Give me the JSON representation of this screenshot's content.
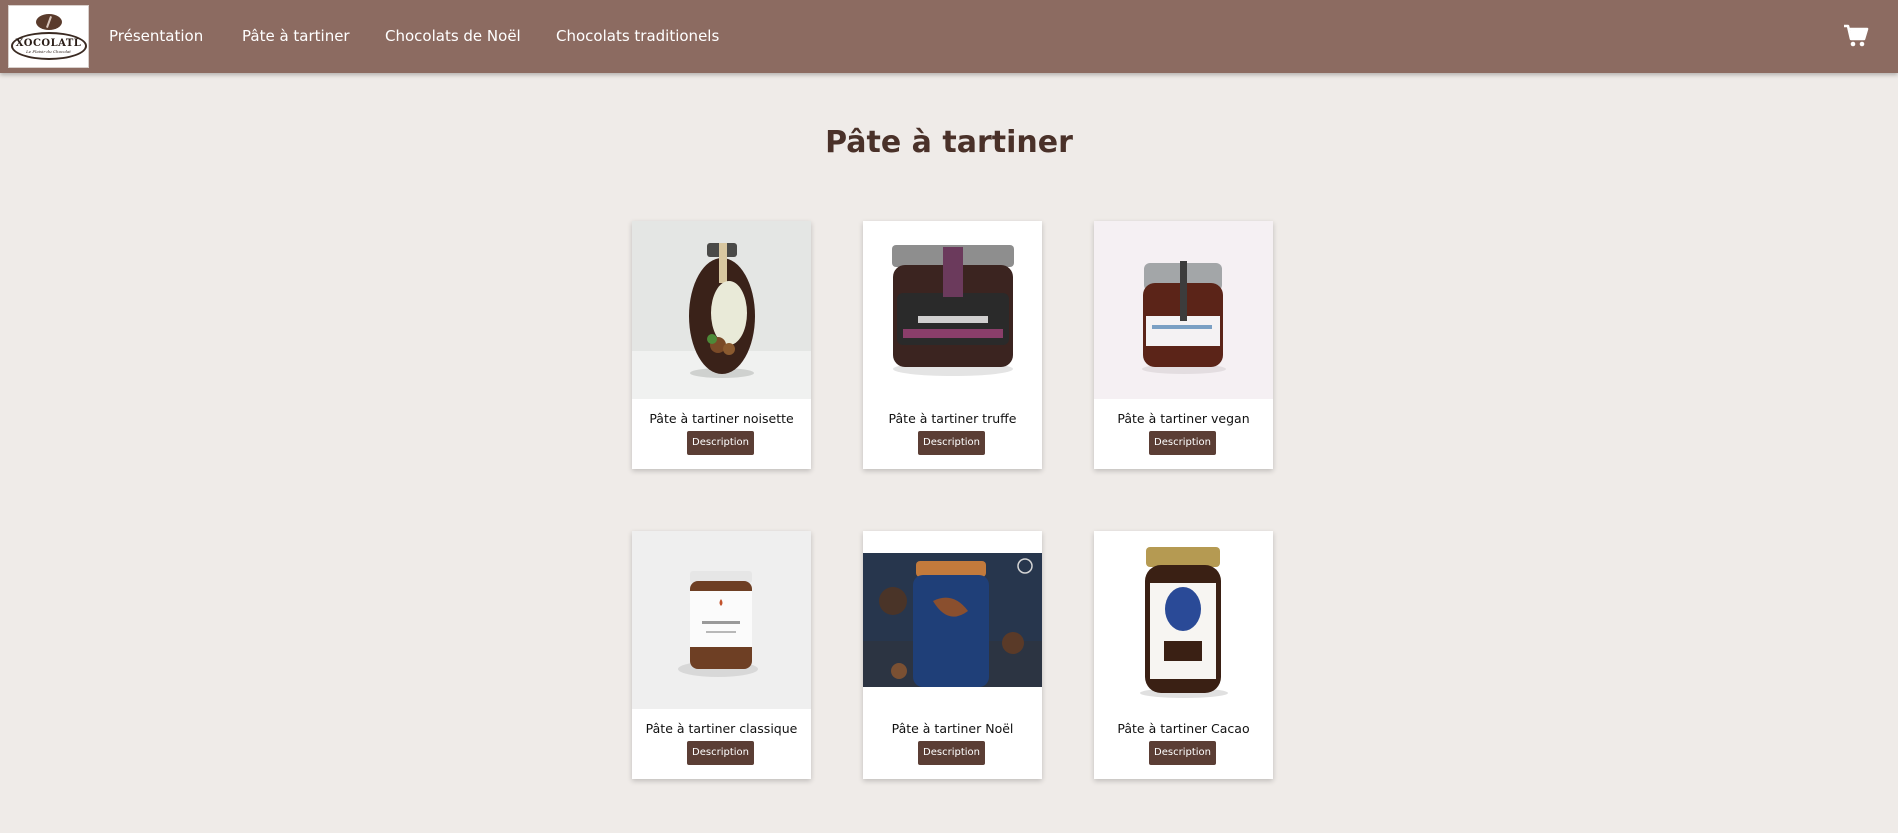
{
  "nav": {
    "logo_text": "XOCOLATL",
    "logo_subtext": "Le Plaisir du Chocolat",
    "links": [
      "Présentation",
      "Pâte à tartiner",
      "Chocolats de Noël",
      "Chocolats traditionels"
    ],
    "cart_icon": "shopping-cart-icon"
  },
  "page": {
    "title": "Pâte à tartiner"
  },
  "products": [
    {
      "name": "Pâte à tartiner noisette",
      "button": "Description"
    },
    {
      "name": "Pâte à tartiner truffe",
      "button": "Description"
    },
    {
      "name": "Pâte à tartiner vegan",
      "button": "Description"
    },
    {
      "name": "Pâte à tartiner classique",
      "button": "Description"
    },
    {
      "name": "Pâte à tartiner Noël",
      "button": "Description"
    },
    {
      "name": "Pâte à tartiner Cacao",
      "button": "Description"
    }
  ],
  "colors": {
    "navbar": "#8c6b61",
    "background": "#efebe8",
    "button": "#5b3e35",
    "title": "#4a3129"
  }
}
